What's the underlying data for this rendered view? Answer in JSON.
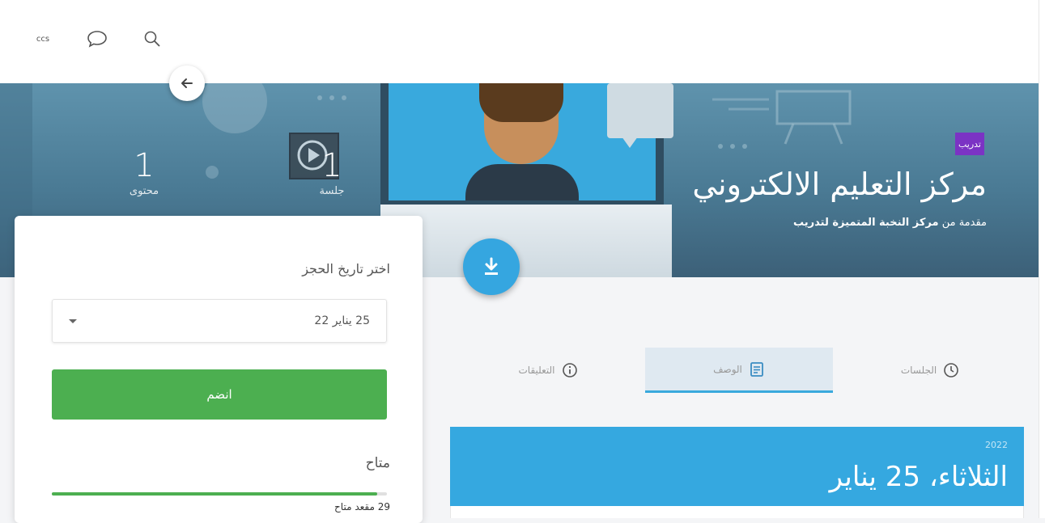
{
  "topbar": {
    "ccs_label": "ccs"
  },
  "course": {
    "tag": "تدريب",
    "title": "مركز التعليم الالكتروني",
    "subtitle_prefix": "مقدمة من",
    "provider": "مركز النخبة المتميزة لتدريب"
  },
  "stats": {
    "content_count": "1",
    "content_label": "محتوى",
    "session_count": "1",
    "session_label": "جلسة"
  },
  "booking": {
    "label": "اختر تاريخ الحجز",
    "selected_date": "25 يناير 22",
    "join_label": "انضم",
    "available_label": "متاح",
    "available_count": "29 مقعد متاح",
    "available_fraction": 0.97
  },
  "tabs": [
    {
      "label": "الجلسات",
      "icon": "clock-icon"
    },
    {
      "label": "الوصف",
      "icon": "description-icon"
    },
    {
      "label": "التعليقات",
      "icon": "info-icon"
    }
  ],
  "session_date": {
    "year": "2022",
    "day": "الثلاثاء، 25 يناير"
  },
  "colors": {
    "accent": "#35a8e0",
    "join": "#4caf50",
    "tag": "#7b33c4"
  }
}
